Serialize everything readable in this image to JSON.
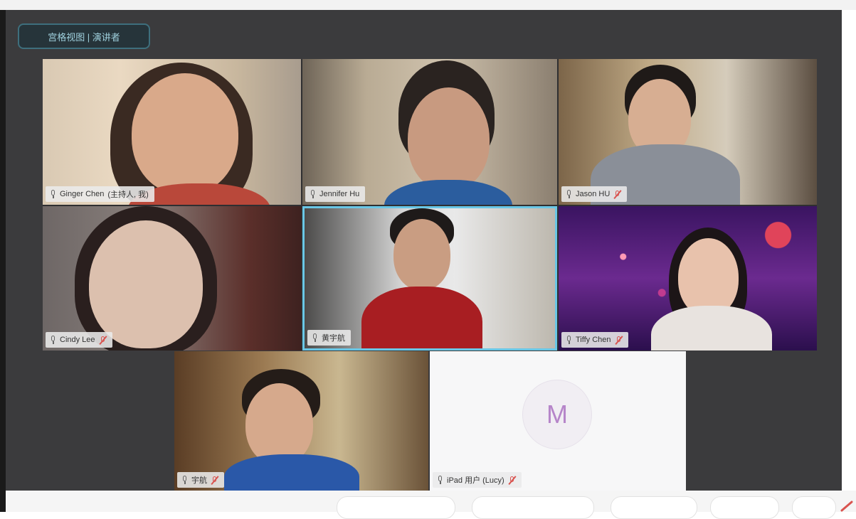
{
  "view_button": {
    "label": "宫格视图 | 演讲者"
  },
  "participants": [
    {
      "name": "Ginger Chen",
      "role_tag": "(主持人, 我)",
      "muted": false
    },
    {
      "name": "Jennifer Hu",
      "role_tag": "",
      "muted": false
    },
    {
      "name": "Jason HU",
      "role_tag": "",
      "muted": true
    },
    {
      "name": "Cindy Lee",
      "role_tag": "",
      "muted": true
    },
    {
      "name": "黄宇航",
      "role_tag": "",
      "muted": false,
      "speaking": true
    },
    {
      "name": "Tiffy Chen",
      "role_tag": "",
      "muted": true
    },
    {
      "name": "宇航",
      "role_tag": "",
      "muted": true
    },
    {
      "name": "iPad 用户 (Lucy)",
      "role_tag": "",
      "muted": true,
      "avatar_letter": "M"
    }
  ],
  "colors": {
    "meeting_bg": "#3b3b3d",
    "active_border": "#69c7e6",
    "muted_icon": "#d9534f",
    "avatar_letter": "#b685c9"
  },
  "icons": {
    "mic": "mic-icon",
    "muted": "mic-muted-icon"
  }
}
